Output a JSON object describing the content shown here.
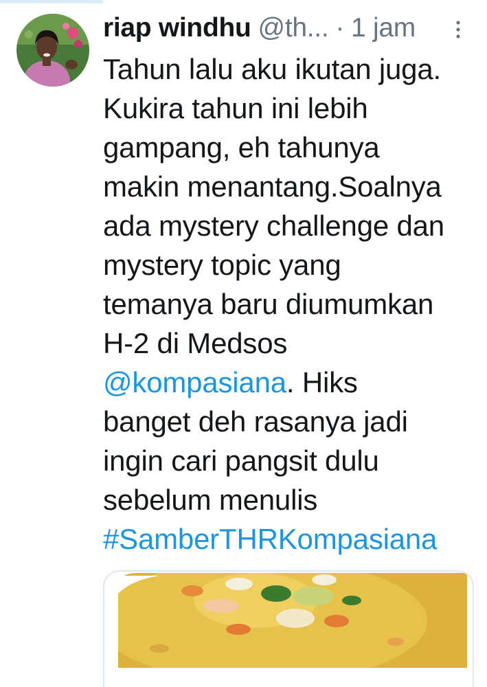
{
  "tweet": {
    "author_name": "riap windhu",
    "author_handle": "@th...",
    "separator": "·",
    "timestamp": "1 jam",
    "body_text_1": "Tahun lalu aku ikutan juga.\nKukira tahun ini lebih\ngampang, eh tahunya\nmakin menantang.Soalnya\nada mystery challenge dan\nmystery topic yang\ntemanya baru diumumkan\nH-2 di Medsos\n",
    "mention": "@kompasiana",
    "body_text_2": ". Hiks\nbanget deh rasanya jadi\ningin cari pangsit dulu\nsebelum menulis\n",
    "hashtag": "#SamberTHRKompasiana"
  },
  "icons": {
    "more": "more-vertical-icon"
  },
  "colors": {
    "link": "#1b95e0",
    "text": "#14171a",
    "secondary": "#66757f",
    "border": "#e1e8ed"
  }
}
